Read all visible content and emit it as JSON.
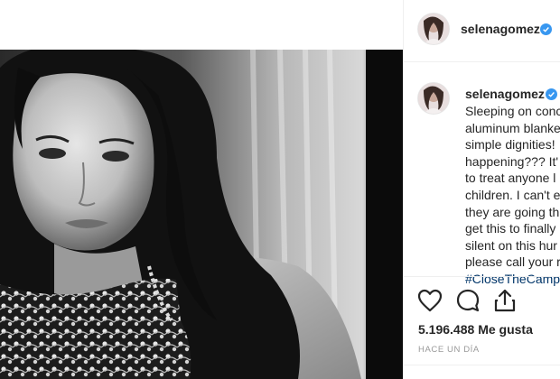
{
  "post": {
    "username": "selenagomez",
    "caption_username": "selenagomez",
    "caption_lines": [
      "Sleeping on conc",
      "aluminum blanke",
      "simple dignities!",
      "happening??? It'",
      "to treat anyone l",
      "children. I can't e",
      "they are going th",
      "get this to finally",
      "silent on this hur",
      "please call your r"
    ],
    "caption_hashtag": "#CloseTheCamp",
    "likes_count": "5.196.488",
    "likes_label": "Me gusta",
    "timestamp": "HACE UN DÍA"
  },
  "icons": {
    "verified": "verified-badge-icon",
    "like": "heart-icon",
    "comment": "comment-bubble-icon",
    "share": "share-upload-icon"
  },
  "colors": {
    "verified_blue": "#3897f0",
    "text": "#262626",
    "muted": "#999999",
    "hashtag": "#003569",
    "divider": "#efefef"
  }
}
